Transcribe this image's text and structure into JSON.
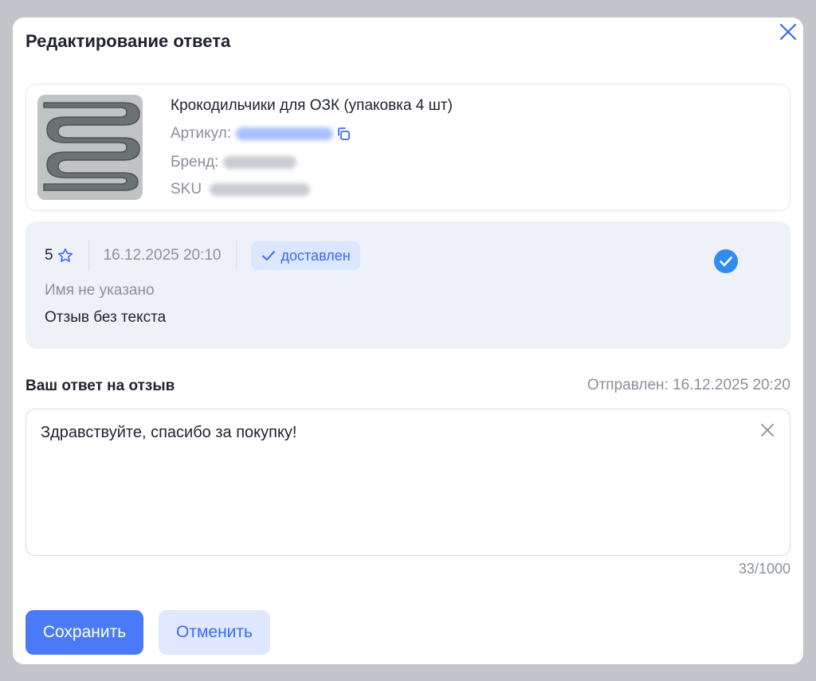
{
  "modal": {
    "title": "Редактирование ответа"
  },
  "product": {
    "name": "Крокодильчики для ОЗК (упаковка 4 шт)",
    "article_label": "Артикул:",
    "brand_label": "Бренд:",
    "sku_label": "SKU"
  },
  "review": {
    "rating": "5",
    "date": "16.12.2025 20:10",
    "status": "доставлен",
    "author": "Имя не указано",
    "text": "Отзыв без текста"
  },
  "reply": {
    "label": "Ваш ответ на отзыв",
    "sent_info": "Отправлен: 16.12.2025 20:20",
    "text": "Здравствуйте, спасибо за покупку!",
    "counter": "33/1000"
  },
  "actions": {
    "save_label": "Сохранить",
    "cancel_label": "Отменить"
  },
  "colors": {
    "accent": "#4a7af7",
    "accent_light": "#dfe8ff",
    "review_bg": "#eef2f8",
    "overlay": "#c4c5cb",
    "verified": "#2f8cf0"
  },
  "icons": {
    "close": "close-icon",
    "copy": "copy-icon",
    "rating": "star-outline-icon",
    "status": "check-icon",
    "verified": "check-circle-icon",
    "clear": "clear-icon"
  }
}
